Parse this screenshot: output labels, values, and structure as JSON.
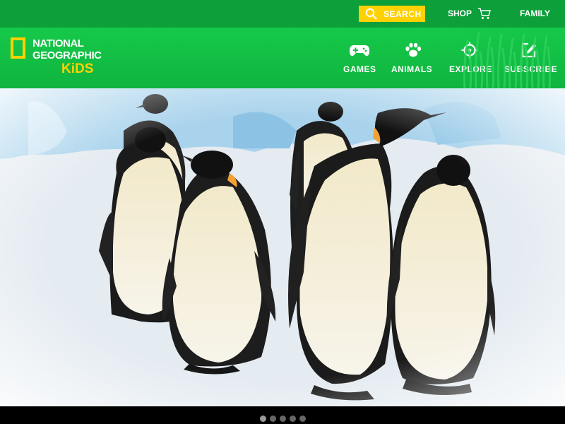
{
  "topbar": {
    "search_label": "SEARCH",
    "shop_label": "SHOP",
    "family_label": "FAMILY"
  },
  "logo": {
    "line1": "NATIONAL",
    "line2": "GEOGRAPHIC",
    "line3": "KiDS"
  },
  "nav": {
    "games_label": "GAMES",
    "animals_label": "ANIMALS",
    "explore_label": "EXPLORE",
    "subscribe_label": "SUBSCRIBE"
  },
  "colors": {
    "topbar_green": "#0c9f3a",
    "nav_green": "#16c94a",
    "accent_yellow": "#ffd100"
  },
  "carousel": {
    "slide_count": 5,
    "active_slide": 1
  }
}
